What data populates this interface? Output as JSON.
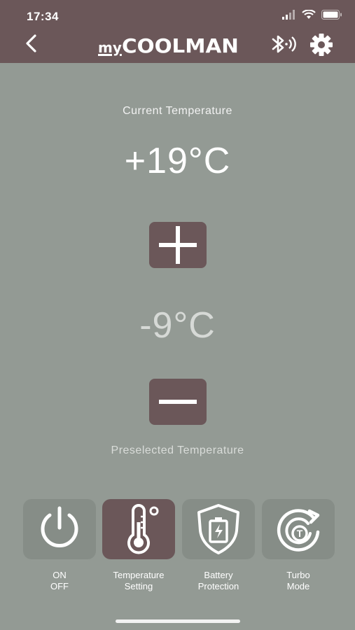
{
  "status_bar": {
    "time": "17:34"
  },
  "header": {
    "brand_prefix": "my",
    "brand_name": "COOLMAN",
    "icons": [
      "back-chevron-icon",
      "bluetooth-icon",
      "gear-icon"
    ]
  },
  "current": {
    "label": "Current Temperature",
    "value": "+19°C"
  },
  "preset": {
    "value": "-9°C",
    "label": "Preselected Temperature"
  },
  "controls": {
    "increase_icon": "plus-icon",
    "decrease_icon": "minus-icon"
  },
  "modes": [
    {
      "line1": "ON",
      "line2": "OFF",
      "icon": "power-icon",
      "active": false
    },
    {
      "line1": "Temperature",
      "line2": "Setting",
      "icon": "thermometer-icon",
      "active": true
    },
    {
      "line1": "Battery",
      "line2": "Protection",
      "icon": "battery-shield-icon",
      "active": false
    },
    {
      "line1": "Turbo",
      "line2": "Mode",
      "icon": "turbo-icon",
      "active": false
    }
  ],
  "colors": {
    "header_bg": "#6b5759",
    "page_bg": "#939a94",
    "tile_bg": "#868d87",
    "tile_active_bg": "#6b5759"
  }
}
